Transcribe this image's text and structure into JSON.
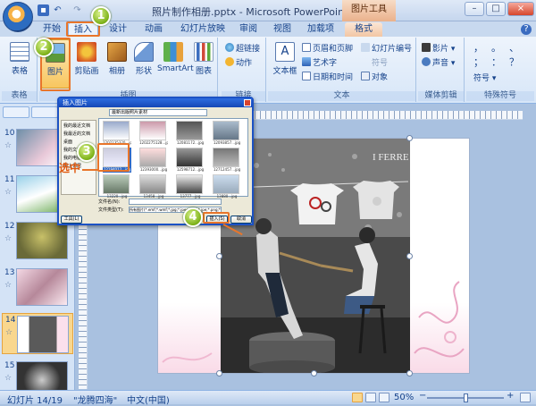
{
  "app": {
    "title": "照片制作相册.pptx - Microsoft PowerPoint",
    "context_tools": "图片工具",
    "help": "?"
  },
  "window": {
    "minimize": "–",
    "maximize": "□",
    "close": "×"
  },
  "tabs": [
    {
      "label": "开始"
    },
    {
      "label": "插入",
      "active": true
    },
    {
      "label": "设计"
    },
    {
      "label": "动画"
    },
    {
      "label": "幻灯片放映"
    },
    {
      "label": "审阅"
    },
    {
      "label": "视图"
    },
    {
      "label": "加载项"
    },
    {
      "label": "格式"
    }
  ],
  "ribbon": {
    "groups": {
      "tables": "表格",
      "illustrations": "插图",
      "links": "链接",
      "text": "文本",
      "media": "媒体剪辑",
      "symbols": "特殊符号"
    },
    "buttons": {
      "table": "表格",
      "picture": "图片",
      "clipart": "剪贴画",
      "album": "相册",
      "shapes": "形状",
      "smartart": "SmartArt",
      "chart": "图表",
      "hyperlink": "超链接",
      "action": "动作",
      "textbox": "文本框",
      "header_footer": "页眉和页脚",
      "wordart": "艺术字",
      "datetime": "日期和时间",
      "slide_number": "幻灯片编号",
      "symbol": "符号",
      "object": "对象",
      "movie": "影片",
      "sound": "声音",
      "special_symbol": "符号"
    },
    "symbol_grid": [
      "，",
      "。",
      "、",
      "；",
      "：",
      "？"
    ]
  },
  "slides_pane": {
    "items": [
      {
        "num": "10"
      },
      {
        "num": "11"
      },
      {
        "num": "12"
      },
      {
        "num": "13"
      },
      {
        "num": "14",
        "selected": true
      },
      {
        "num": "15"
      }
    ],
    "star": "☆"
  },
  "dialog": {
    "title": "插入图片",
    "path": "最新出版照片素材",
    "sidebar": [
      "我的最近文档",
      "我最近的文档",
      "桌面",
      "我的文档",
      "我的电脑",
      "网上邻居"
    ],
    "files": [
      {
        "name": "1202235320...jpg"
      },
      {
        "name": "1202275128...jpg"
      },
      {
        "name": "12081172...jpg"
      },
      {
        "name": "12093857...jpg"
      },
      {
        "name": "12194012...jpg",
        "selected": true
      },
      {
        "name": "12393000...jpg"
      },
      {
        "name": "12598712...jpg"
      },
      {
        "name": "12712457...jpg"
      },
      {
        "name": "13220...jpg"
      },
      {
        "name": "13458...jpg"
      },
      {
        "name": "13777...jpg"
      },
      {
        "name": "13880...jpg"
      }
    ],
    "filename_label": "文件名(N):",
    "filetype_label": "文件类型(T):",
    "filetype_value": "所有图片(*.emf;*.wmf;*.jpg;*.jpeg;*.jfif;*.jpe;*.png;*.bmp;*.dib...",
    "tools": "工具(L)",
    "insert": "插入(S)",
    "cancel": "取消"
  },
  "annotations": {
    "step1": "1",
    "step2": "2",
    "step3": "3",
    "step4": "4",
    "select_label": "选中"
  },
  "photo_text": {
    "sign": "I FERRE"
  },
  "statusbar": {
    "slide_info": "幻灯片 14/19",
    "theme": "\"龙腾四海\"",
    "language": "中文(中国)",
    "zoom": "50%",
    "zoom_minus": "−",
    "zoom_plus": "+"
  }
}
